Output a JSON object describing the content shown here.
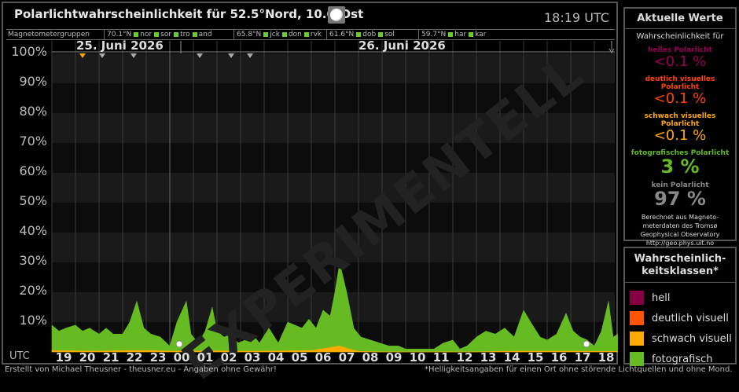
{
  "title": "Polarlichtwahrscheinlichkeit für 52.5°Nord, 10.0°Ost",
  "time": "18:19 UTC",
  "magnetometer": {
    "label": "Magnetometergruppen",
    "groups": [
      {
        "lat": "70.1°N",
        "stations": [
          "nor",
          "sor",
          "tro",
          "and"
        ]
      },
      {
        "lat": "65.8°N",
        "stations": [
          "jck",
          "don",
          "rvk"
        ]
      },
      {
        "lat": "61.6°N",
        "stations": [
          "dob",
          "sol"
        ]
      },
      {
        "lat": "59.7°N",
        "stations": [
          "har",
          "kar"
        ]
      }
    ]
  },
  "dates": [
    "25. Juni 2026",
    "26. Juni 2026"
  ],
  "watermark": "EXPERIMENTELL",
  "utc_label": "UTC",
  "footer_left": "Erstellt von Michael Theusner - theusner.eu - Angaben ohne Gewähr!",
  "footer_right": "*Helligkeitsangaben für einen Ort ohne störende Lichtquellen und ohne Mond.",
  "current": {
    "heading": "Aktuelle Werte",
    "prob_label": "Wahrscheinlichkeit für",
    "levels": [
      {
        "label": "helles Polarlicht",
        "value": "<0.1 %",
        "color": "#990055"
      },
      {
        "label": "deutlich visuelles Polarlicht",
        "value": "<0.1 %",
        "color": "#ff4400"
      },
      {
        "label": "schwach visuelles Polarlicht",
        "value": "<0.1 %",
        "color": "#ffaa00"
      },
      {
        "label": "fotografisches Polarlicht",
        "value": "3 %",
        "color": "#66bb22"
      },
      {
        "label": "kein Polarlicht",
        "value": "97 %",
        "color": "#888888"
      }
    ],
    "source": [
      "Berechnet aus Magneto-",
      "meterdaten des Tromsø",
      "Geophysical Observatory",
      "http://geo.phys.uit.no"
    ]
  },
  "classes": {
    "heading_lines": [
      "Wahrscheinlich-",
      "keitsklassen*"
    ],
    "items": [
      {
        "label": "hell",
        "color": "#880044"
      },
      {
        "label": "deutlich visuell",
        "color": "#ff5500"
      },
      {
        "label": "schwach visuell",
        "color": "#ffaa00"
      },
      {
        "label": "fotografisch",
        "color": "#66bb22"
      }
    ]
  },
  "chart_data": {
    "type": "area",
    "ylim": [
      0,
      100
    ],
    "y_ticks": [
      "10%",
      "20%",
      "30%",
      "40%",
      "50%",
      "60%",
      "70%",
      "80%",
      "90%",
      "100%"
    ],
    "x_ticks": [
      "19",
      "20",
      "21",
      "22",
      "23",
      "00",
      "01",
      "02",
      "03",
      "04",
      "05",
      "06",
      "07",
      "08",
      "09",
      "10",
      "11",
      "12",
      "13",
      "14",
      "15",
      "16",
      "17",
      "18"
    ],
    "xlim": [
      0,
      24
    ],
    "series": [
      {
        "name": "fotografisch",
        "color": "#66bb22",
        "x": [
          0,
          0.3,
          0.6,
          1.0,
          1.3,
          1.6,
          2.0,
          2.3,
          2.6,
          3.0,
          3.3,
          3.6,
          3.9,
          4.2,
          4.6,
          5.0,
          5.3,
          5.7,
          5.9,
          6.2,
          6.5,
          6.8,
          7.0,
          7.3,
          7.6,
          7.9,
          8.2,
          8.5,
          8.8,
          9.2,
          9.6,
          10.0,
          10.3,
          10.6,
          10.9,
          11.2,
          11.5,
          11.8,
          12.0,
          12.2,
          12.5,
          12.8,
          13.1,
          13.5,
          13.9,
          14.3,
          14.7,
          15.0,
          15.4,
          15.8,
          16.2,
          16.6,
          17.0,
          17.3,
          17.6,
          18.0,
          18.4,
          18.8,
          19.2,
          19.6,
          20.0,
          20.3,
          20.7,
          21.0,
          21.4,
          21.8,
          22.1,
          22.4,
          22.7,
          23.0,
          23.3,
          23.6,
          23.8,
          24.0
        ],
        "y": [
          9,
          7,
          8,
          9,
          7,
          8,
          6,
          8,
          6,
          6,
          10,
          17,
          8,
          6,
          5,
          2,
          10,
          17,
          6,
          3,
          7,
          15,
          7,
          5,
          6,
          3,
          4,
          6,
          3,
          8,
          3,
          10,
          9,
          8,
          11,
          8,
          14,
          12,
          20,
          30,
          20,
          8,
          5,
          4,
          3,
          2,
          2,
          1,
          1,
          1,
          1,
          3,
          4,
          1,
          2,
          5,
          7,
          6,
          8,
          5,
          14,
          10,
          5,
          4,
          6,
          13,
          7,
          5,
          4,
          2,
          7,
          17,
          5,
          6
        ]
      },
      {
        "name": "schwach visuell",
        "color": "#ffaa00",
        "x": [
          0,
          1,
          2,
          3,
          4,
          5,
          6,
          7,
          8,
          9,
          10,
          11,
          11.8,
          12.2,
          12.6,
          13,
          14,
          15,
          16,
          17,
          18,
          19,
          20,
          21,
          22,
          23,
          24
        ],
        "y": [
          0.5,
          0.4,
          0.3,
          0.5,
          0.5,
          0.3,
          0.3,
          0.4,
          0.3,
          0.3,
          0.4,
          0.5,
          1.5,
          2,
          1,
          0.2,
          0,
          0,
          0,
          0,
          0,
          0.2,
          0.3,
          0.3,
          0.3,
          0.2,
          0.2
        ]
      }
    ],
    "moon_markers": [
      "#ffaa00",
      "#aaaaaa",
      "#aaaaaa",
      "#aaaaaa",
      "#aaaaaa",
      "#aaaaaa",
      "#ffaa00"
    ]
  }
}
